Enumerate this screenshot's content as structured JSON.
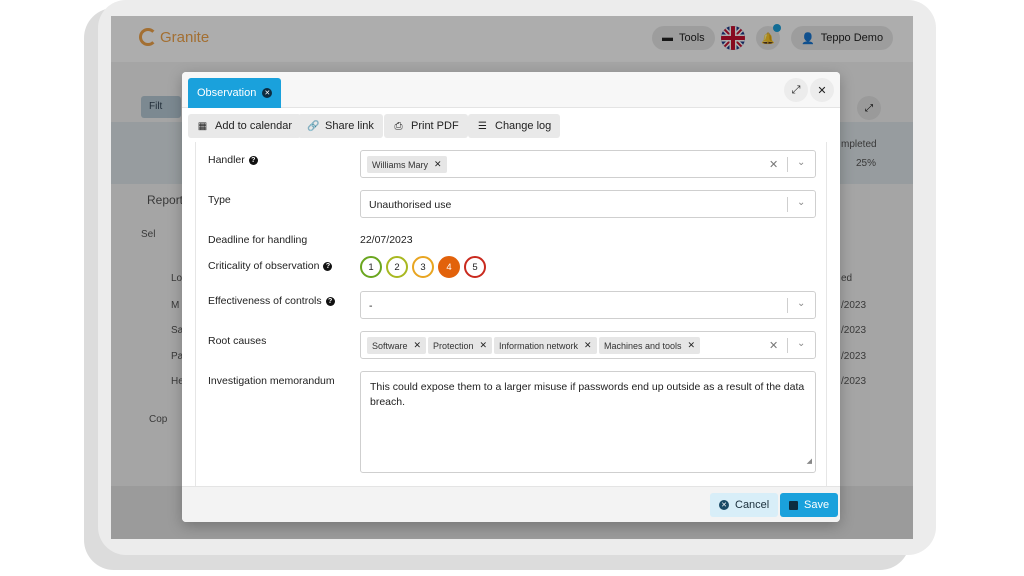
{
  "app": {
    "logo_text": "Granite",
    "tools_label": "Tools",
    "user_label": "Teppo Demo"
  },
  "background": {
    "filter_label": "Filt",
    "completed_label": "mpleted",
    "percent": "25%",
    "report_label": "Report",
    "select_label": "Sel",
    "col_label": "Lo",
    "date_header": "ed",
    "date_suffix": "/2023",
    "row_initials": [
      "M",
      "Sa",
      "Pa",
      "He"
    ],
    "copy_label": "Cop"
  },
  "modal": {
    "tab_label": "Observation",
    "toolbar": {
      "calendar": "Add to calendar",
      "share": "Share link",
      "pdf": "Print PDF",
      "changelog": "Change log"
    },
    "fields": {
      "handler_label": "Handler",
      "handler_chip": "Williams Mary",
      "type_label": "Type",
      "type_value": "Unauthorised use",
      "deadline_label": "Deadline for handling",
      "deadline_value": "22/07/2023",
      "criticality_label": "Criticality of observation",
      "criticality_options": [
        "1",
        "2",
        "3",
        "4",
        "5"
      ],
      "criticality_selected": "4",
      "effectiveness_label": "Effectiveness of controls",
      "effectiveness_value": "-",
      "root_causes_label": "Root causes",
      "root_causes": [
        "Software",
        "Protection",
        "Information network",
        "Machines and tools"
      ],
      "memo_label": "Investigation memorandum",
      "memo_value": "This could expose them to a larger misuse if passwords end up outside as a result of the data breach."
    },
    "footer": {
      "cancel": "Cancel",
      "save": "Save"
    }
  },
  "colors": {
    "accent": "#1aa1dc",
    "logo": "#f0a44a",
    "crit_1": "#6aa61f",
    "crit_2": "#a8b820",
    "crit_3": "#e8a521",
    "crit_4": "#e2620b",
    "crit_5": "#c92a1e"
  }
}
